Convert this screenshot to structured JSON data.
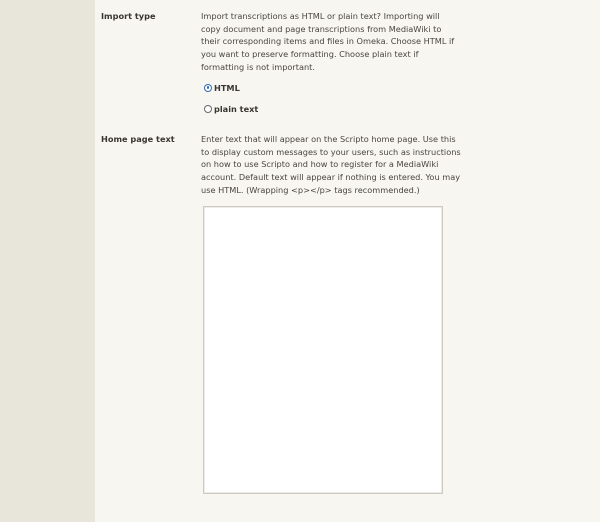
{
  "form": {
    "import_type": {
      "label": "Import type",
      "explanation": "Import transcriptions as HTML or plain text? Importing will copy document and page transcriptions from MediaWiki to their corresponding items and files in Omeka. Choose HTML if you want to preserve formatting. Choose plain text if formatting is not important.",
      "options": [
        {
          "label": "HTML",
          "selected": true
        },
        {
          "label": "plain text",
          "selected": false
        }
      ]
    },
    "home_page_text": {
      "label": "Home page text",
      "explanation": "Enter text that will appear on the Scripto home page. Use this to display custom messages to your users, such as instructions on how to use Scripto and how to register for a MediaWiki account. Default text will appear if nothing is entered. You may use HTML. (Wrapping <p></p> tags recommended.)",
      "value": ""
    }
  },
  "colors": {
    "left_gutter": "#e8e5da",
    "content_bg": "#f7f6f1",
    "accent_radio": "#2f6bb8",
    "text": "#3a3631"
  }
}
